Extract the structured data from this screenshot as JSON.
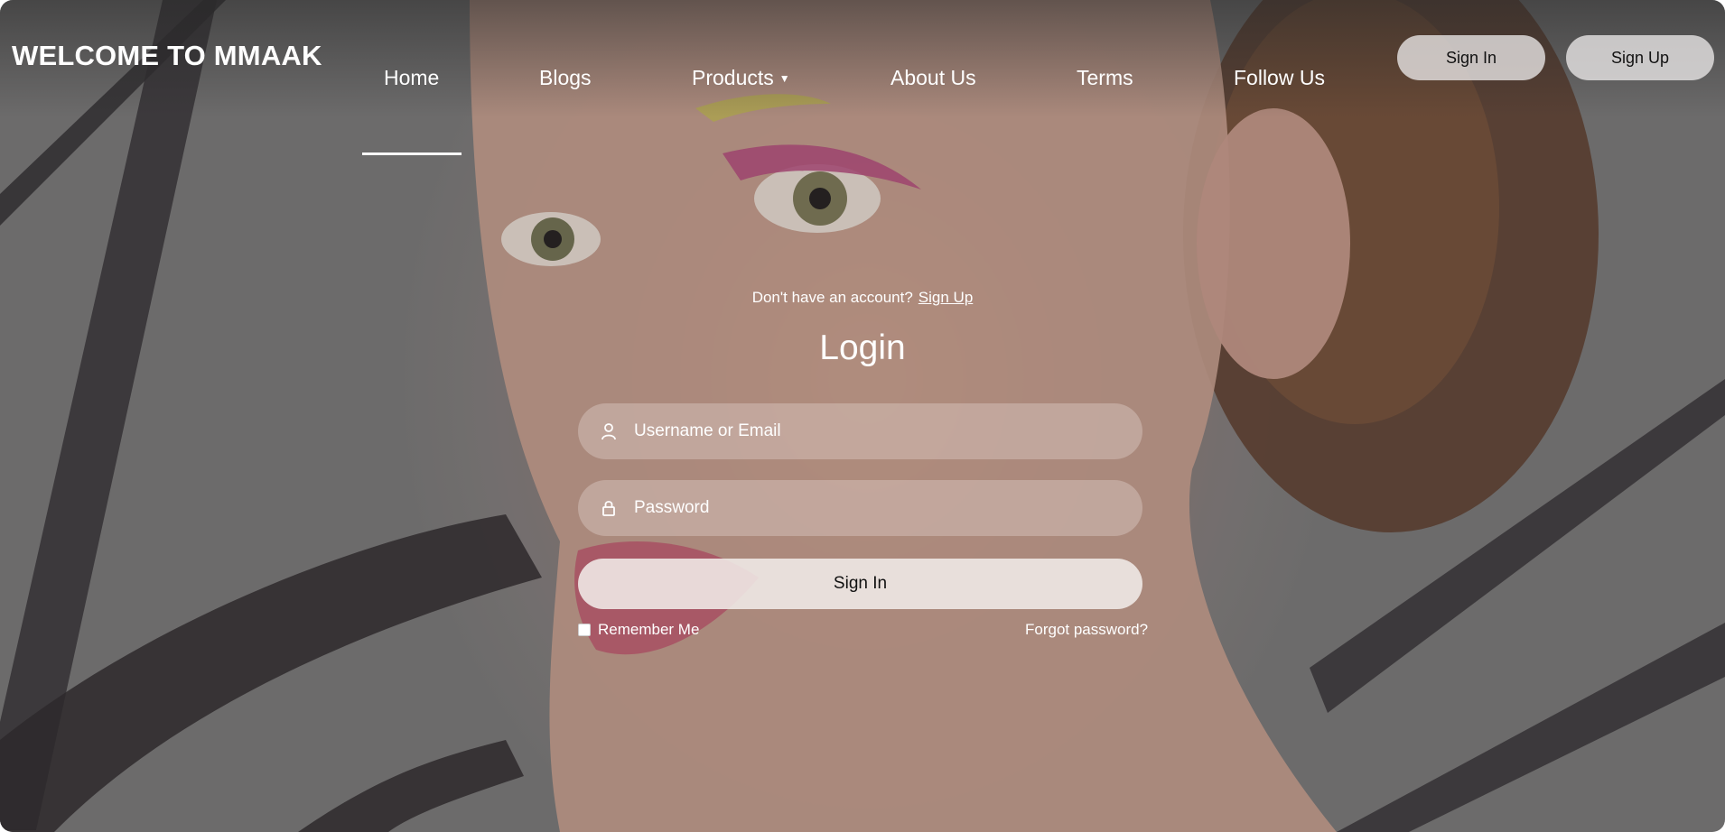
{
  "brand": {
    "title": "WELCOME TO MMAAK"
  },
  "nav": {
    "items": [
      {
        "label": "Home",
        "active": true
      },
      {
        "label": "Blogs"
      },
      {
        "label": "Products",
        "has_dropdown": true
      },
      {
        "label": "About Us"
      },
      {
        "label": "Terms"
      },
      {
        "label": "Follow Us"
      }
    ]
  },
  "header_buttons": {
    "sign_in": "Sign In",
    "sign_up": "Sign Up"
  },
  "login": {
    "prompt": "Don't have an account?",
    "signup_link": "Sign Up",
    "title": "Login",
    "username_placeholder": "Username or Email",
    "password_placeholder": "Password",
    "submit_label": "Sign In",
    "remember_label": "Remember Me",
    "forgot_label": "Forgot password?"
  },
  "icons": {
    "caret": "caret-down-icon",
    "user": "user-icon",
    "lock": "lock-icon"
  },
  "colors": {
    "text": "#ffffff",
    "button_bg": "#ebe8e8",
    "button_text": "#111111"
  }
}
